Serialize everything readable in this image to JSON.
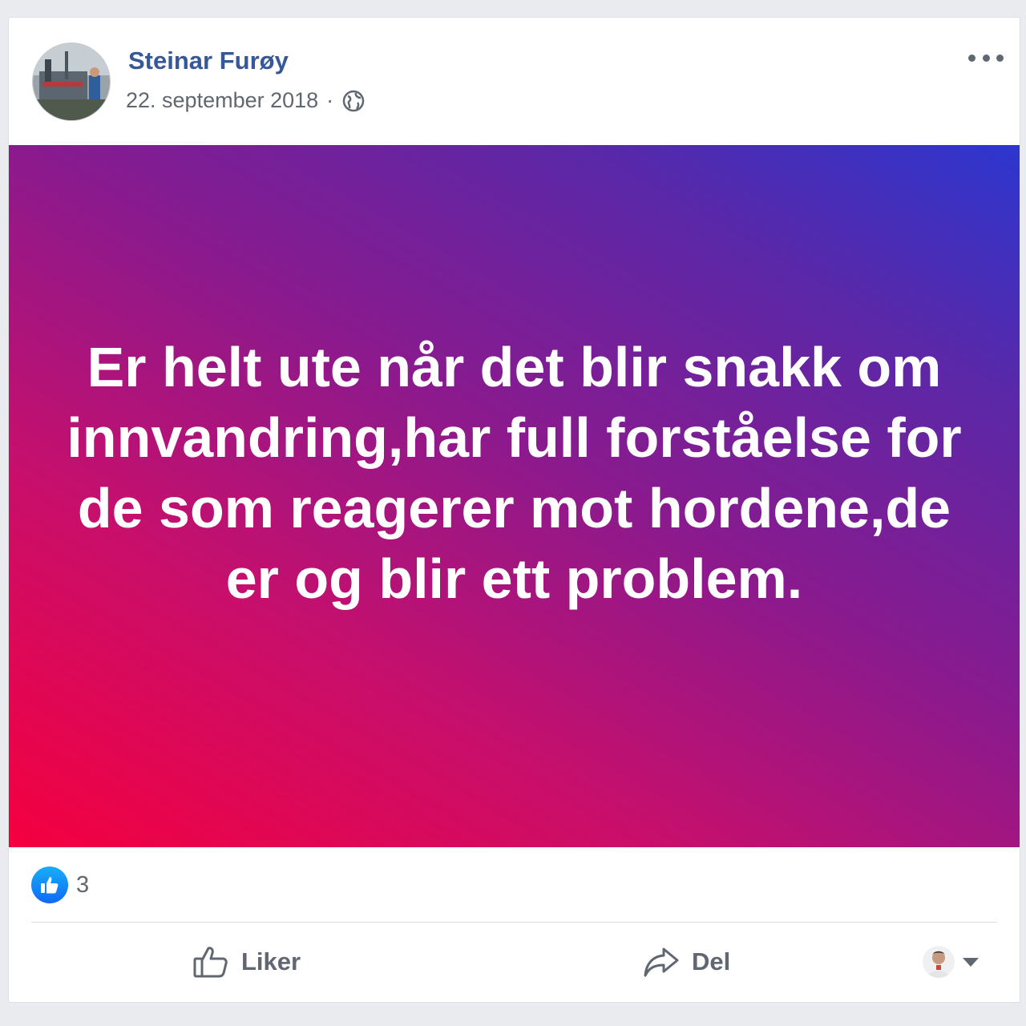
{
  "post": {
    "author": "Steinar Furøy",
    "date": "22. september 2018",
    "separator": "·",
    "privacy_icon": "globe-icon",
    "options_icon": "more-options-icon",
    "text": "Er helt ute når det blir snakk om innvandring,har full forståelse for de som reagerer mot hordene,de er og blir ett problem.",
    "background_colors": [
      "#f5003f",
      "#8a1a8e",
      "#2c36cf"
    ]
  },
  "reactions": {
    "icon": "like-reaction-icon",
    "count": "3"
  },
  "actions": {
    "like_label": "Liker",
    "share_label": "Del"
  },
  "colors": {
    "author_link": "#365899",
    "secondary_text": "#616770",
    "like_blue": "#0e6af5"
  }
}
